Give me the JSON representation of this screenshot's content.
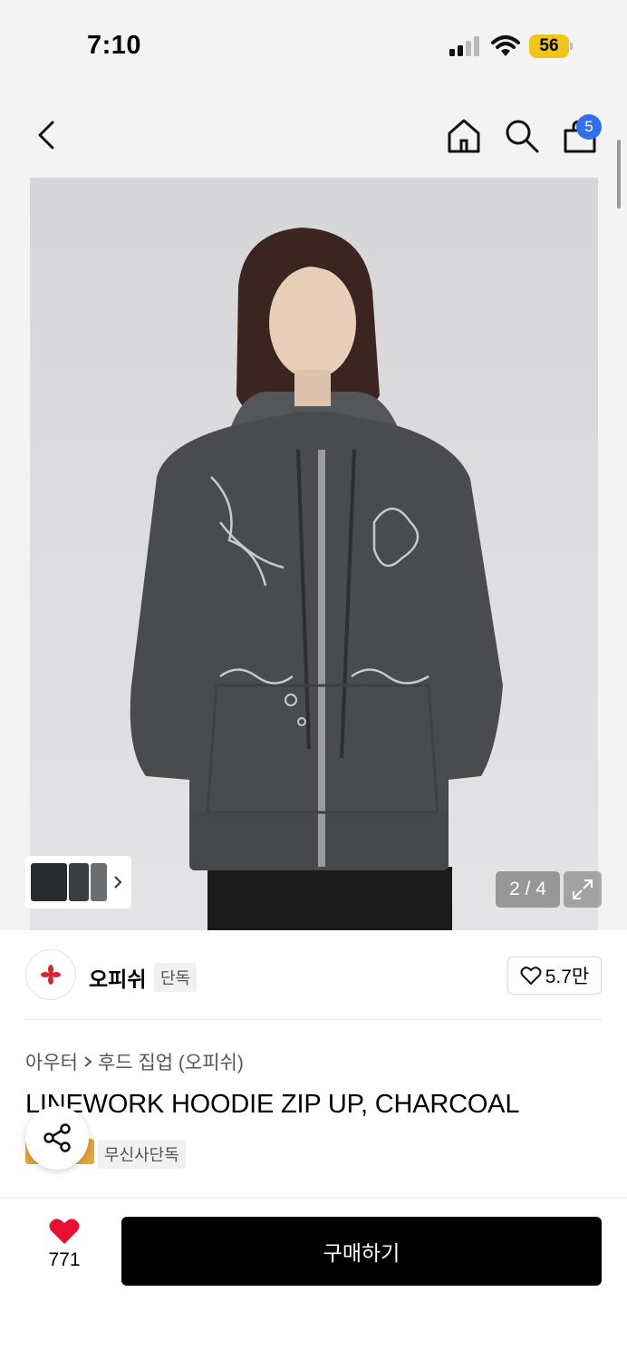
{
  "status_bar": {
    "time": "7:10",
    "battery": "56"
  },
  "header": {
    "cart_badge": "5"
  },
  "gallery": {
    "counter": "2 / 4"
  },
  "brand": {
    "name": "오피쉬",
    "tag": "단독",
    "likes": "5.7만"
  },
  "product": {
    "breadcrumb": [
      "아우터",
      "후드 집업 (오피쉬)"
    ],
    "title": "LINEWORK HOODIE ZIP UP, CHARCOAL",
    "exclusive_tag": "무신사단독"
  },
  "bottom": {
    "like_count": "771",
    "buy_label": "구매하기"
  },
  "colors": {
    "badge": "#2f6ff0",
    "heart": "#e8102e",
    "buy_button": "#000000",
    "battery": "#f0c419",
    "hoodie": "#4a4b4f"
  }
}
